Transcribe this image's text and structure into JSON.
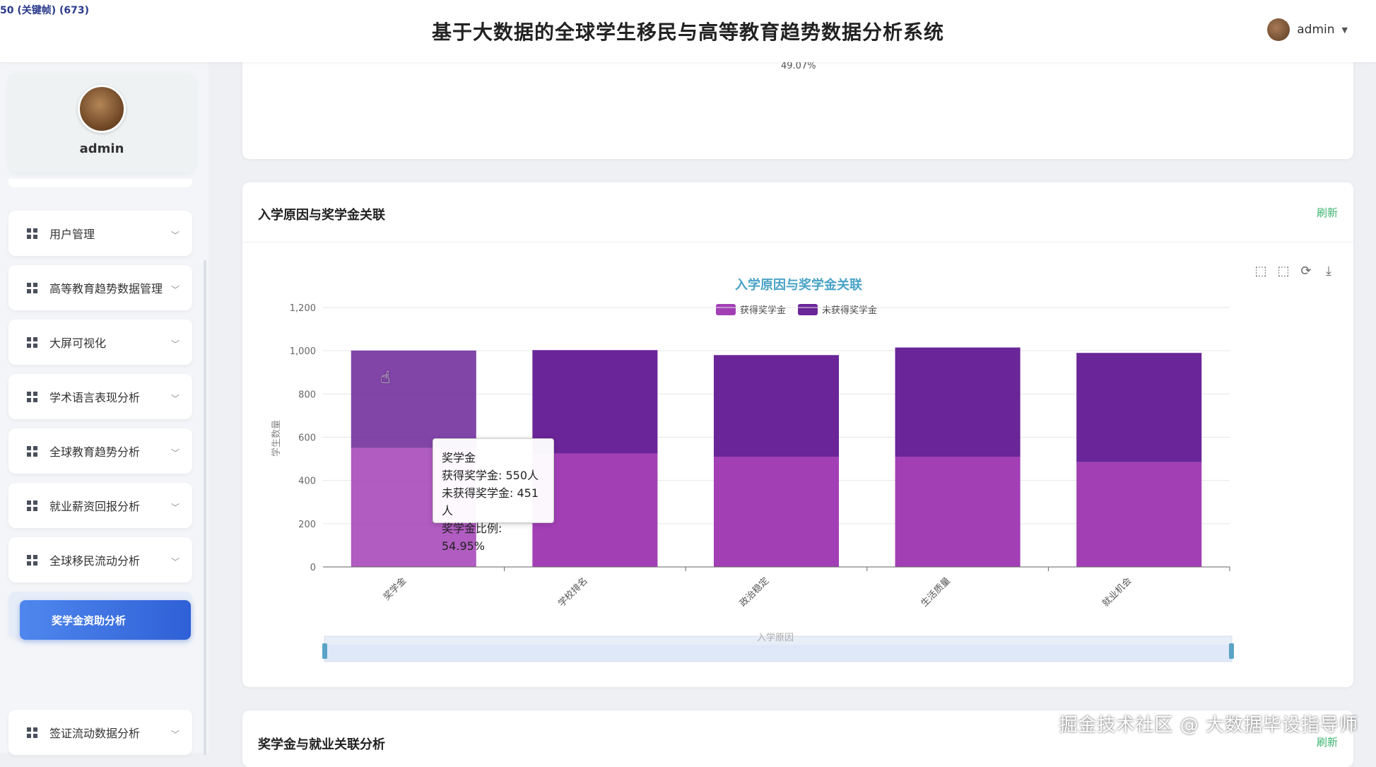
{
  "header": {
    "counter": "50 (关键帧) (673)",
    "title": "基于大数据的全球学生移民与高等教育趋势数据分析系统",
    "user": "admin"
  },
  "sidebar": {
    "profile_name": "admin",
    "items": [
      {
        "label": "用户管理"
      },
      {
        "label": "高等教育趋势数据管理"
      },
      {
        "label": "大屏可视化"
      },
      {
        "label": "学术语言表现分析"
      },
      {
        "label": "全球教育趋势分析"
      },
      {
        "label": "就业薪资回报分析"
      },
      {
        "label": "全球移民流动分析"
      },
      {
        "label": "奖学金资助分析"
      },
      {
        "label": "签证流动数据分析"
      }
    ],
    "submenu_active": "奖学金资助分析"
  },
  "top_card": {
    "pie_percent_label": "49.07%"
  },
  "chart_card": {
    "title": "入学原因与奖学金关联",
    "refresh": "刷新"
  },
  "bottom_card": {
    "title": "奖学金与就业关联分析",
    "refresh": "刷新"
  },
  "tooltip": {
    "category": "奖学金",
    "line1": "获得奖学金: 550人",
    "line2": "未获得奖学金: 451人",
    "line3": "奖学金比例: 54.95%"
  },
  "zoom_label": "入学原因",
  "watermark": "掘金技术社区 @ 大数据毕设指导师",
  "colors": {
    "got": "#a23fb5",
    "not_got": "#6a2598",
    "accent": "#3a6fd8",
    "refresh": "#3cb371",
    "chart_title": "#4aa3c7"
  },
  "chart_data": {
    "type": "bar",
    "stacked": true,
    "title": "入学原因与奖学金关联",
    "ylabel": "学生数量",
    "xlabel": "入学原因",
    "ylim": [
      0,
      1200
    ],
    "yticks": [
      "0",
      "200",
      "400",
      "600",
      "800",
      "1,000",
      "1,200"
    ],
    "categories": [
      "奖学金",
      "学校排名",
      "政治稳定",
      "生活质量",
      "就业机会"
    ],
    "series": [
      {
        "name": "获得奖学金",
        "values": [
          550,
          525,
          510,
          510,
          485
        ]
      },
      {
        "name": "未获得奖学金",
        "values": [
          451,
          478,
          470,
          505,
          505
        ]
      }
    ],
    "legend_position": "top-center",
    "grid": true
  }
}
